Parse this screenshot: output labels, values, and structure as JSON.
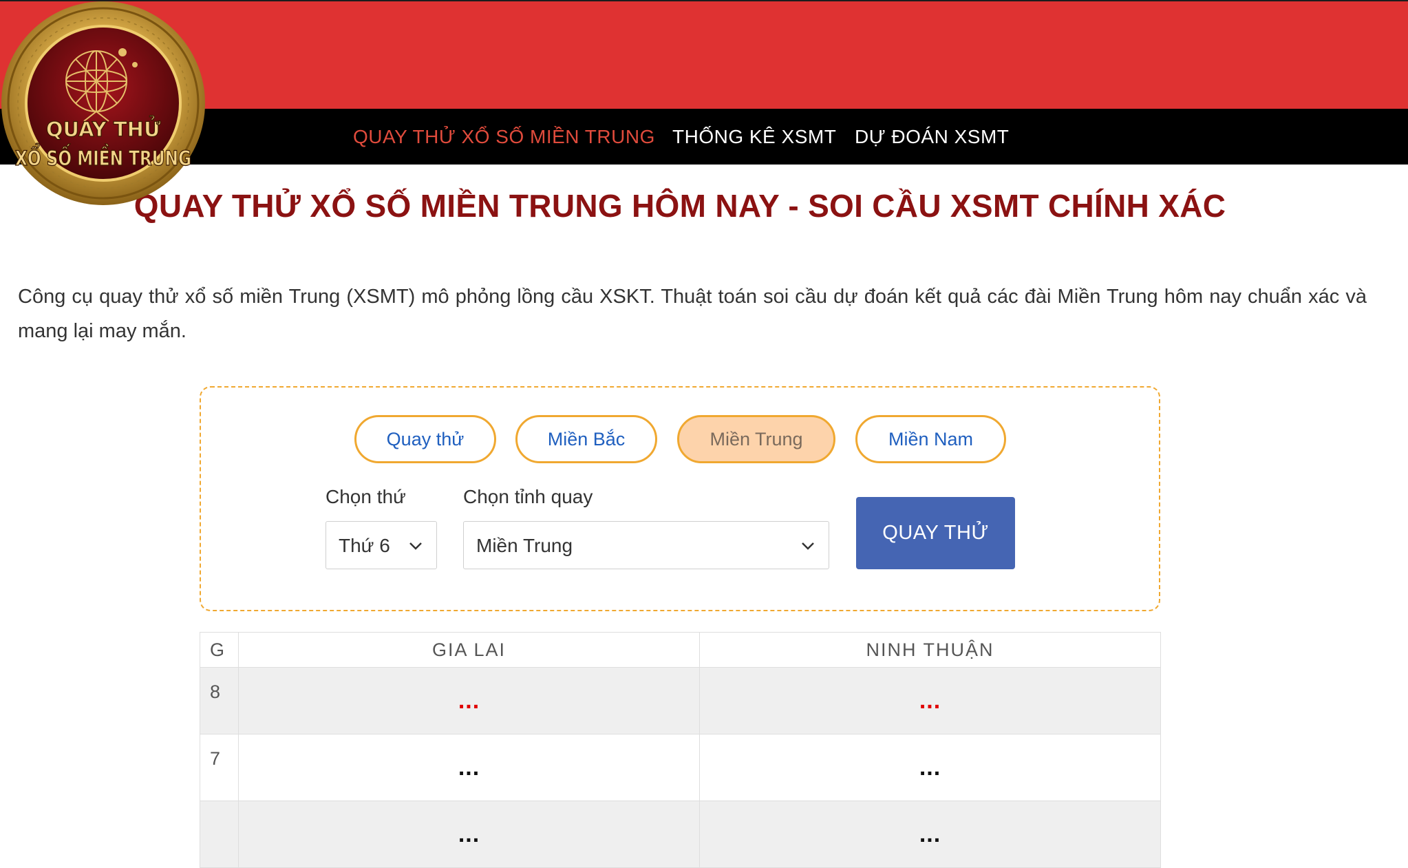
{
  "logo": {
    "line1": "QUAY THỬ",
    "line2": "XỔ SỐ MIỀN TRUNG"
  },
  "nav": {
    "items": [
      {
        "label": "QUAY THỬ XỔ SỐ MIỀN TRUNG",
        "active": true
      },
      {
        "label": "THỐNG KÊ XSMT",
        "active": false
      },
      {
        "label": "DỰ ĐOÁN XSMT",
        "active": false
      }
    ]
  },
  "page": {
    "title": "QUAY THỬ XỔ SỐ MIỀN TRUNG HÔM NAY - SOI CẦU XSMT CHÍNH XÁC",
    "intro": "Công cụ quay thử xổ số miền Trung (XSMT) mô phỏng lồng cầu XSKT. Thuật toán soi cầu dự đoán kết quả các đài Miền Trung hôm nay chuẩn xác và mang lại may mắn."
  },
  "tool": {
    "tabs": [
      {
        "label": "Quay thử",
        "active": false
      },
      {
        "label": "Miền Bắc",
        "active": false
      },
      {
        "label": "Miền Trung",
        "active": true
      },
      {
        "label": "Miền Nam",
        "active": false
      }
    ],
    "day_label": "Chọn thứ",
    "day_value": "Thứ 6",
    "province_label": "Chọn tỉnh quay",
    "province_value": "Miền Trung",
    "submit_label": "QUAY THỬ"
  },
  "table": {
    "headers": [
      "G",
      "GIA LAI",
      "NINH THUẬN"
    ],
    "rows": [
      {
        "prize": "8",
        "values": [
          "...",
          "..."
        ]
      },
      {
        "prize": "7",
        "values": [
          "...",
          "..."
        ]
      },
      {
        "prize": "",
        "values": [
          "...",
          "..."
        ]
      }
    ]
  },
  "colors": {
    "header_red": "#df3232",
    "nav_black": "#000000",
    "active_nav": "#e04b3c",
    "title_red": "#8b1212",
    "tab_border": "#f0a830",
    "tab_active_bg": "#fdd3ab",
    "link_blue": "#1f5fbf",
    "submit_blue": "#4565b3",
    "prize8_red": "#e00000"
  },
  "icons": [
    "chevron-down-icon",
    "lottery-cage-icon"
  ]
}
